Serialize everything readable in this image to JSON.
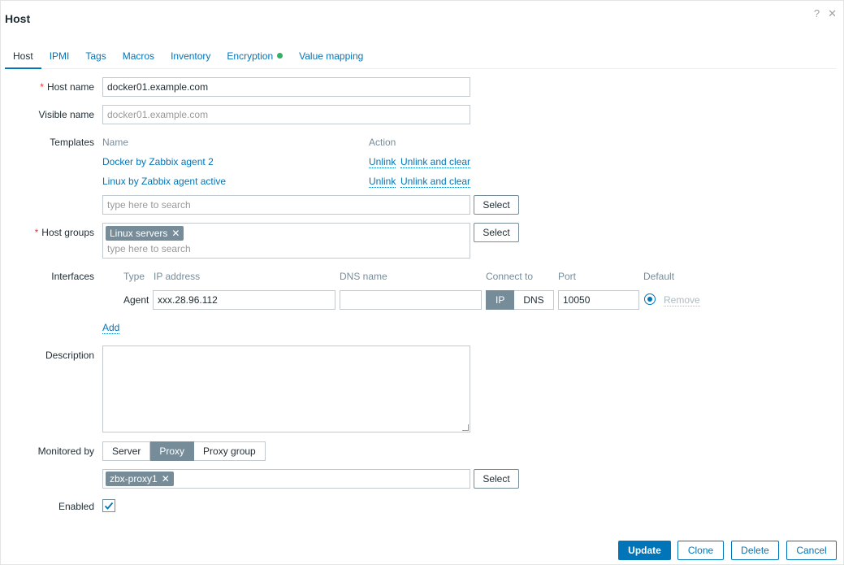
{
  "dialog": {
    "title": "Host",
    "help_glyph": "?",
    "close_glyph": "✕"
  },
  "tabs": [
    {
      "label": "Host"
    },
    {
      "label": "IPMI"
    },
    {
      "label": "Tags"
    },
    {
      "label": "Macros"
    },
    {
      "label": "Inventory"
    },
    {
      "label": "Encryption"
    },
    {
      "label": "Value mapping"
    }
  ],
  "colors": {
    "accent": "#0275b8",
    "required": "#e33734",
    "chip": "#768d99",
    "status_ok": "#34af67"
  },
  "form": {
    "host_name": {
      "label": "Host name",
      "required_mark": "*",
      "value": "docker01.example.com"
    },
    "visible_name": {
      "label": "Visible name",
      "placeholder": "docker01.example.com"
    },
    "templates": {
      "label": "Templates",
      "col_name": "Name",
      "col_action": "Action",
      "rows": [
        {
          "name": "Docker by Zabbix agent 2",
          "unlink": "Unlink",
          "unlink_clear": "Unlink and clear"
        },
        {
          "name": "Linux by Zabbix agent active",
          "unlink": "Unlink",
          "unlink_clear": "Unlink and clear"
        }
      ],
      "search_placeholder": "type here to search",
      "select_label": "Select"
    },
    "host_groups": {
      "label": "Host groups",
      "required_mark": "*",
      "chips": [
        {
          "label": "Linux servers",
          "remove": "✕"
        }
      ],
      "search_placeholder": "type here to search",
      "select_label": "Select"
    },
    "interfaces": {
      "label": "Interfaces",
      "headers": {
        "type": "Type",
        "ip": "IP address",
        "dns": "DNS name",
        "connect": "Connect to",
        "port": "Port",
        "default": "Default"
      },
      "rows": [
        {
          "type": "Agent",
          "ip": "xxx.28.96.112",
          "dns": "",
          "connect_ip": "IP",
          "connect_dns": "DNS",
          "port": "10050",
          "remove": "Remove"
        }
      ],
      "add_label": "Add"
    },
    "description": {
      "label": "Description",
      "value": ""
    },
    "monitored_by": {
      "label": "Monitored by",
      "options": {
        "server": "Server",
        "proxy": "Proxy",
        "proxy_group": "Proxy group"
      },
      "selected": "Proxy",
      "proxy_chip": "zbx-proxy1",
      "proxy_chip_remove": "✕",
      "select_label": "Select"
    },
    "enabled": {
      "label": "Enabled",
      "checked": true
    }
  },
  "footer": {
    "update": "Update",
    "clone": "Clone",
    "delete": "Delete",
    "cancel": "Cancel"
  }
}
